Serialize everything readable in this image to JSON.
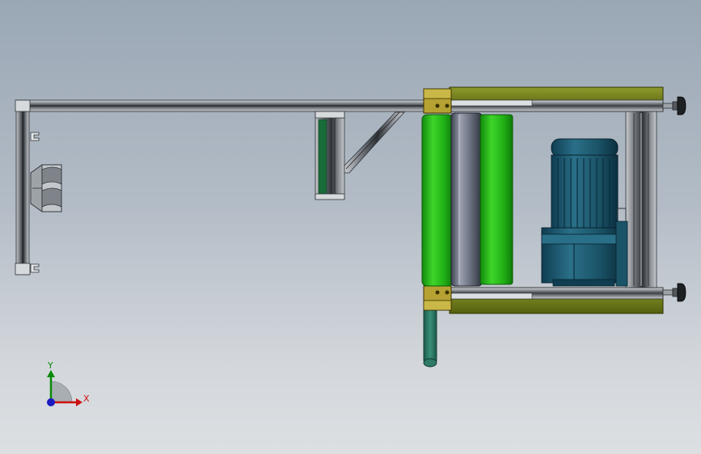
{
  "colors": {
    "frame": "#6f747a",
    "frame_light": "#b9bdc2",
    "frame_dark": "#2e3236",
    "olive": "#6f7b1c",
    "olive_light": "#8e9a2c",
    "brass": "#b5a233",
    "green": "#1fae14",
    "green_light": "#58d640",
    "drum": "#6e7483",
    "motor": "#1f5a70",
    "motor_dark": "#103a4c",
    "teal_pin": "#2f7a68",
    "axis_x": "#cc1010",
    "axis_y": "#0a8a0a",
    "axis_z": "#1a1ac0"
  },
  "axes": {
    "x_label": "X",
    "y_label": "Y"
  }
}
